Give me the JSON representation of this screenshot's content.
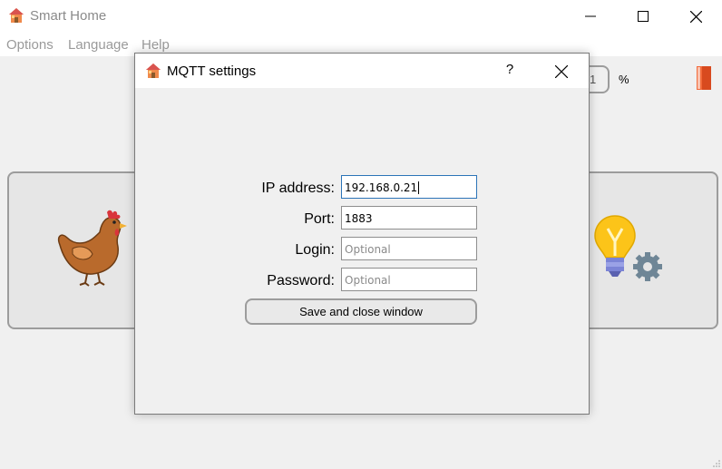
{
  "window": {
    "title": "Smart Home"
  },
  "menu": {
    "items": [
      "Options",
      "Language",
      "Help"
    ]
  },
  "toolbar": {
    "spin_value_partial": "1",
    "unit": "%"
  },
  "icons": {
    "app": "house-icon",
    "minimize": "minimize-icon",
    "maximize": "maximize-icon",
    "close": "close-icon",
    "exit": "exit-door-icon",
    "chicken": "chicken-icon",
    "bulb": "lightbulb-gear-icon"
  },
  "dialog": {
    "title": "MQTT settings",
    "help_label": "?",
    "fields": {
      "ip": {
        "label": "IP address:",
        "value": "192.168.0.21"
      },
      "port": {
        "label": "Port:",
        "value": "1883"
      },
      "login": {
        "label": "Login:",
        "placeholder": "Optional"
      },
      "password": {
        "label": "Password:",
        "placeholder": "Optional"
      }
    },
    "save_label": "Save and close window"
  },
  "colors": {
    "focus": "#2c74b8",
    "exit_door": "#e8552b",
    "chicken_body": "#b96a2c"
  }
}
